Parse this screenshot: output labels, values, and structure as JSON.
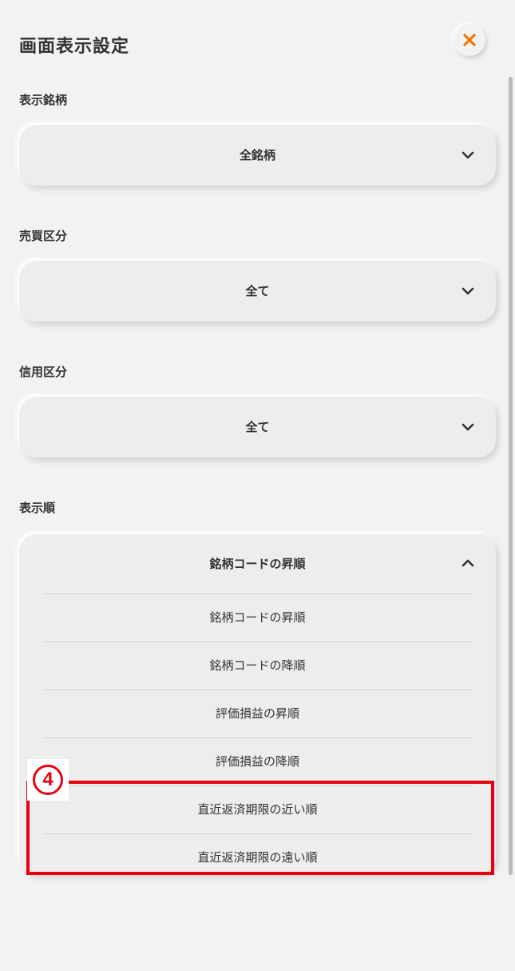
{
  "header": {
    "title": "画面表示設定",
    "close_icon": "close-icon",
    "accent_color": "#f07800"
  },
  "filters": {
    "display_stock": {
      "label": "表示銘柄",
      "selected": "全銘柄",
      "icon": "chevron-down-icon"
    },
    "trade_type": {
      "label": "売買区分",
      "selected": "全て",
      "icon": "chevron-down-icon"
    },
    "credit_type": {
      "label": "信用区分",
      "selected": "全て",
      "icon": "chevron-down-icon"
    },
    "sort_order": {
      "label": "表示順",
      "selected": "銘柄コードの昇順",
      "icon": "chevron-up-icon",
      "expanded": true,
      "options": [
        "銘柄コードの昇順",
        "銘柄コードの降順",
        "評価損益の昇順",
        "評価損益の降順",
        "直近返済期限の近い順",
        "直近返済期限の遠い順"
      ]
    }
  },
  "annotation": {
    "step_number": "4",
    "color": "#e60012"
  }
}
